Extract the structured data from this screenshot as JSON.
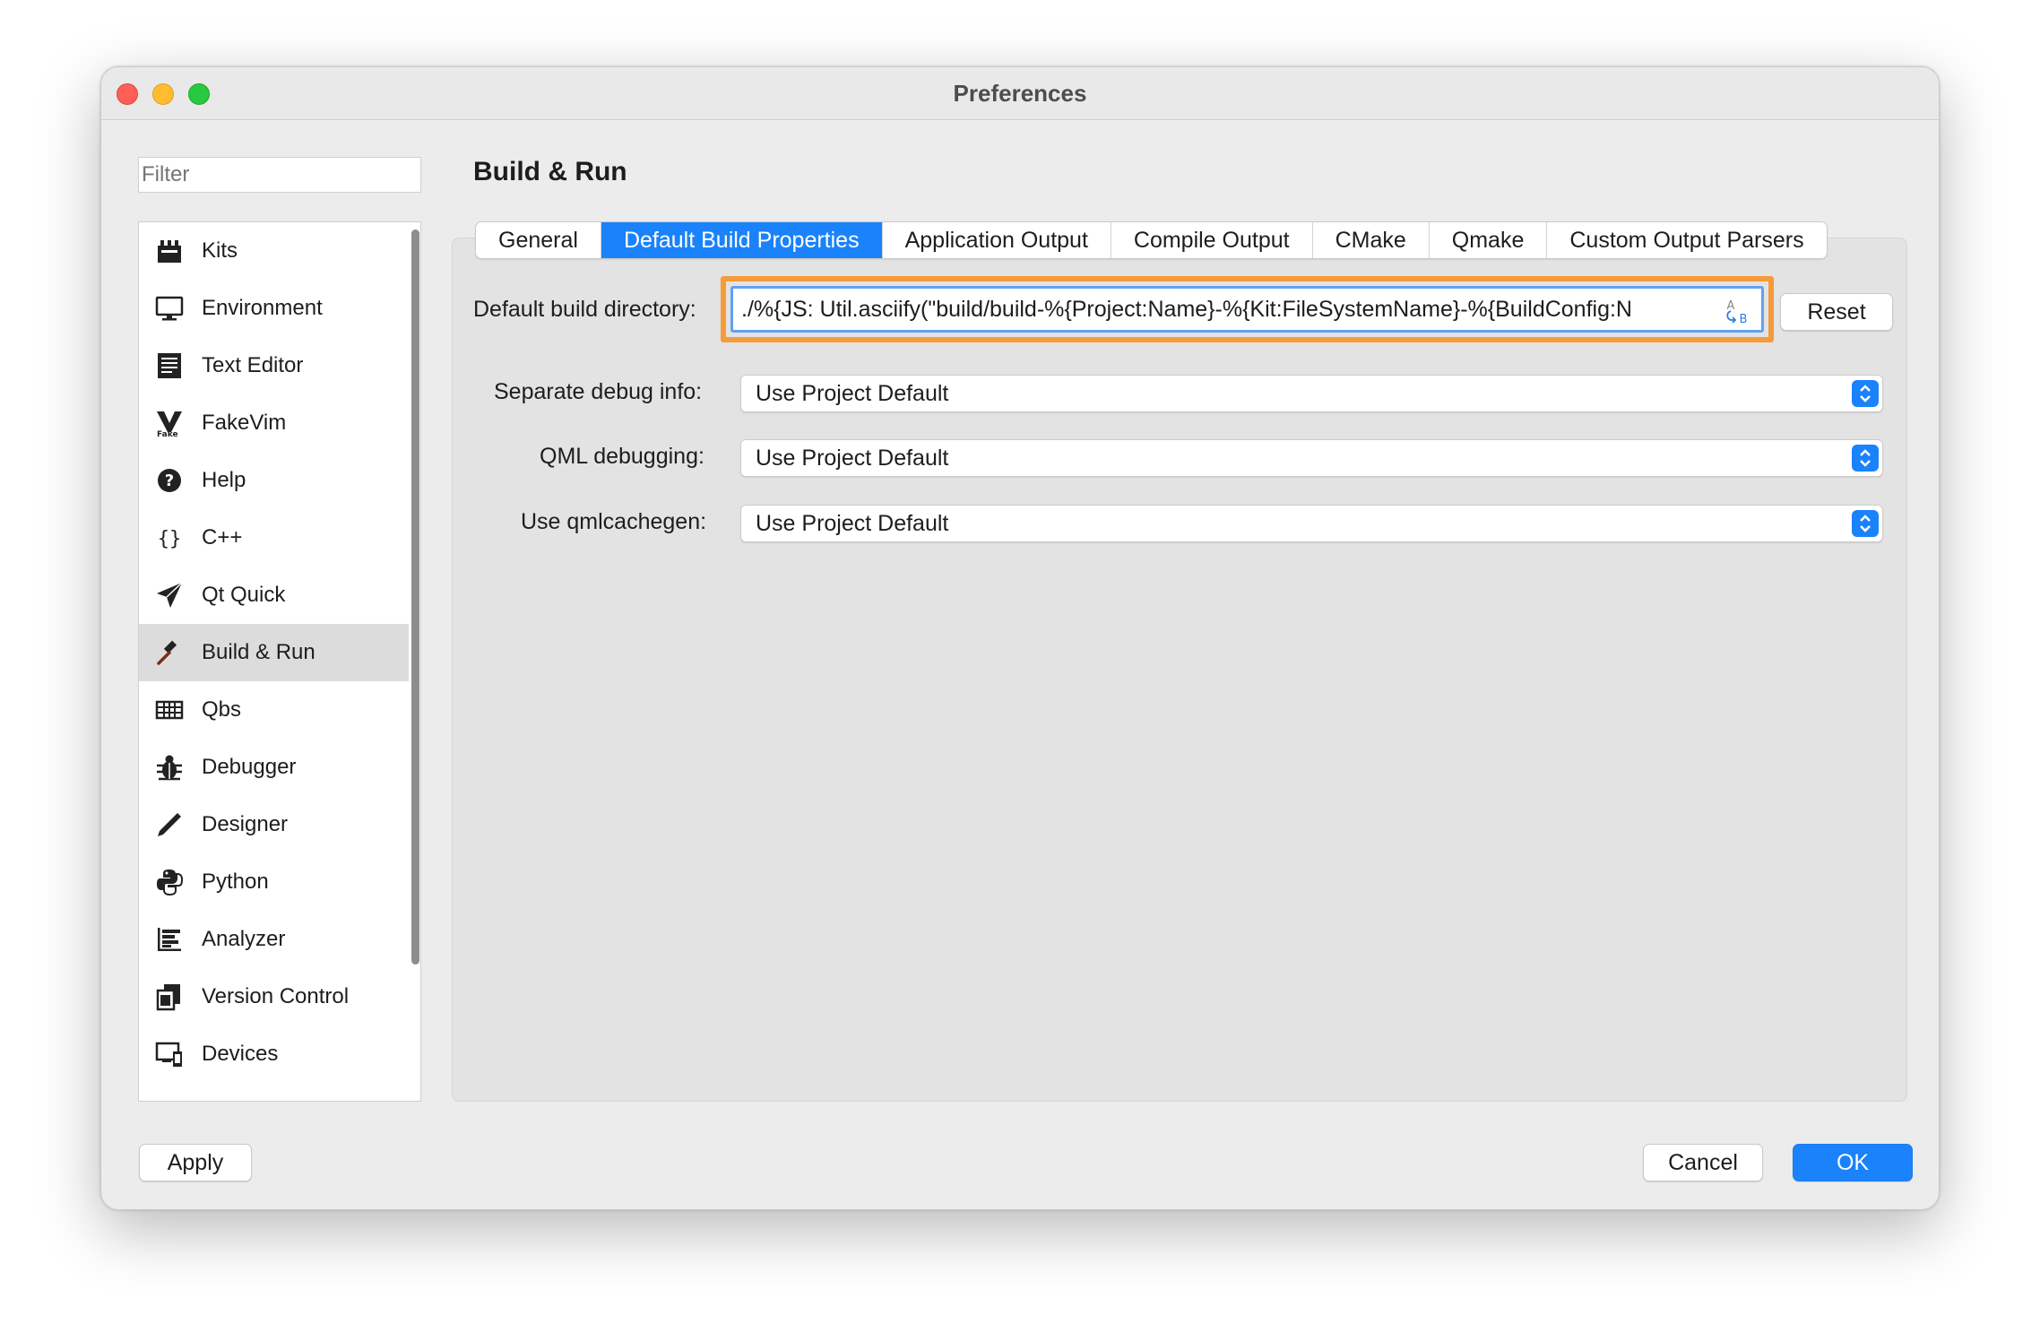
{
  "window": {
    "title": "Preferences"
  },
  "sidebar": {
    "filter_placeholder": "Filter",
    "items": [
      {
        "label": "Kits",
        "icon": "kits-icon"
      },
      {
        "label": "Environment",
        "icon": "monitor-icon"
      },
      {
        "label": "Text Editor",
        "icon": "text-editor-icon"
      },
      {
        "label": "FakeVim",
        "icon": "fakevim-icon"
      },
      {
        "label": "Help",
        "icon": "help-icon"
      },
      {
        "label": "C++",
        "icon": "braces-icon"
      },
      {
        "label": "Qt Quick",
        "icon": "paper-plane-icon"
      },
      {
        "label": "Build & Run",
        "icon": "hammer-icon",
        "selected": true
      },
      {
        "label": "Qbs",
        "icon": "qbs-icon"
      },
      {
        "label": "Debugger",
        "icon": "bug-icon"
      },
      {
        "label": "Designer",
        "icon": "pencil-icon"
      },
      {
        "label": "Python",
        "icon": "python-icon"
      },
      {
        "label": "Analyzer",
        "icon": "analyzer-icon"
      },
      {
        "label": "Version Control",
        "icon": "version-control-icon"
      },
      {
        "label": "Devices",
        "icon": "devices-icon"
      }
    ]
  },
  "main": {
    "title": "Build & Run",
    "tabs": [
      {
        "label": "General",
        "active": false
      },
      {
        "label": "Default Build Properties",
        "active": true
      },
      {
        "label": "Application Output",
        "active": false
      },
      {
        "label": "Compile Output",
        "active": false
      },
      {
        "label": "CMake",
        "active": false
      },
      {
        "label": "Qmake",
        "active": false
      },
      {
        "label": "Custom Output Parsers",
        "active": false
      }
    ],
    "build_dir": {
      "label": "Default build directory:",
      "value": "./%{JS: Util.asciify(\"build/build-%{Project:Name}-%{Kit:FileSystemName}-%{BuildConfig:N",
      "reset_label": "Reset"
    },
    "separate_debug": {
      "label": "Separate debug info:",
      "value": "Use Project Default"
    },
    "qml_debugging": {
      "label": "QML debugging:",
      "value": "Use Project Default"
    },
    "qmlcachegen": {
      "label": "Use qmlcachegen:",
      "value": "Use Project Default"
    }
  },
  "footer": {
    "apply_label": "Apply",
    "cancel_label": "Cancel",
    "ok_label": "OK"
  },
  "colors": {
    "accent": "#1a82fb",
    "highlight": "#f59b3a"
  }
}
